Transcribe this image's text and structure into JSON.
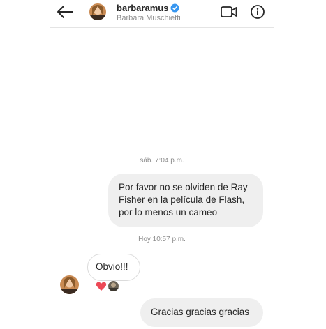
{
  "header": {
    "username": "barbaramus",
    "verified_icon": "verified-badge-icon",
    "fullname": "Barbara Muschietti",
    "back_icon": "arrow-left-icon",
    "video_icon": "video-camera-icon",
    "info_icon": "info-circle-icon"
  },
  "conversation": {
    "timestamp_1": "sáb. 7:04 p.m.",
    "message_1_lines": [
      "Por favor no se olviden de Ray",
      "Fisher en la película de Flash,",
      "por lo menos un cameo"
    ],
    "timestamp_2": "Hoy 10:57 p.m.",
    "reply": "Obvio!!!",
    "reply_reactions": [
      "heart-icon",
      "reactor-avatar"
    ],
    "message_3": "Gracias gracias gracias"
  },
  "colors": {
    "sent_bubble": "#efefef",
    "received_bubble_border": "#dbdbdb",
    "verified_blue": "#3897f0",
    "heart_red": "#ed4956",
    "timestamp_grey": "#8e8e8e"
  }
}
